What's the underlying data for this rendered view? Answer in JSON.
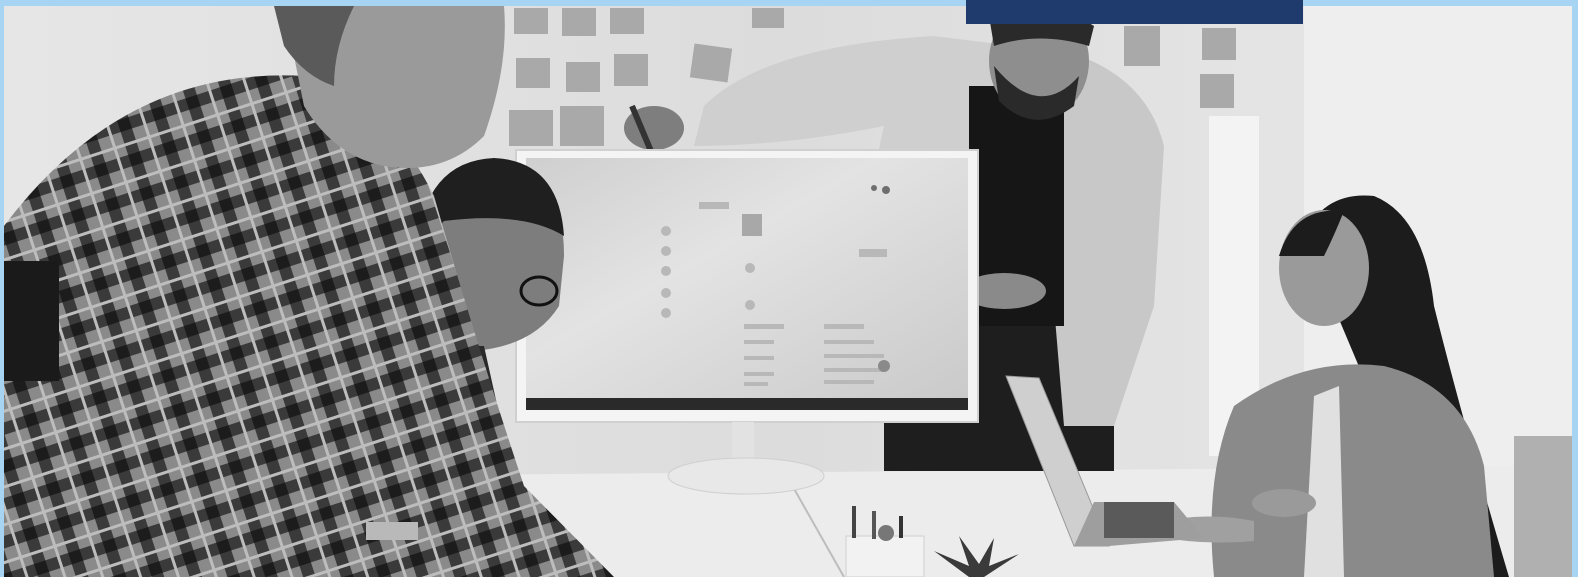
{
  "hero": {
    "image_alt": "",
    "tone": "grayscale",
    "scene": [
      "woman-plaid-shirt",
      "man-glasses",
      "man-presenting",
      "woman-laptop",
      "monitor",
      "sticky-notes",
      "desk",
      "plant",
      "pencil-cup",
      "laptop"
    ]
  },
  "colors": {
    "frame_border": "#a6d4f2",
    "overlay_card": "#1f3a6d",
    "photo_bg": "#d9d9d9"
  }
}
